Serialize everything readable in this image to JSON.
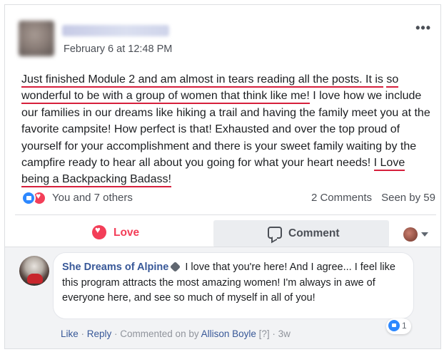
{
  "post": {
    "timestamp": "February 6 at 12:48 PM",
    "text": {
      "hl_1": "Just finished Module 2 and am almost in tears reading all the posts. It is",
      "hl_2": "so wonderful to be with a group of women that think like me!",
      "plain_1": " I love how we include our families in our dreams like hiking a trail and having the family meet you at the favorite campsite! How perfect is that! Exhausted and over the top proud of yourself for your accomplishment and there is your sweet family waiting by the campfire ready to hear all about you going for what your heart needs! ",
      "hl_3": "I Love being a Backpacking Badass!"
    },
    "highlight_color": "#d61f3c",
    "more_label": "•••"
  },
  "reactions": {
    "icons": [
      "like-icon",
      "love-icon"
    ],
    "reactors": "You and 7 others",
    "comments": "2 Comments",
    "seen_by": "Seen by 59"
  },
  "actions": {
    "love_label": "Love",
    "comment_label": "Comment"
  },
  "comment": {
    "author": "She Dreams of Alpine",
    "text": " I love that you're here! And I agree... I feel like this program attracts the most amazing women! I'm always in awe of everyone here, and see so much of myself in all of you!",
    "like_count": "1",
    "meta": {
      "like": "Like",
      "sep1": " · ",
      "reply": "Reply",
      "commented_on_by": " · Commented on by ",
      "by_author": "Allison Boyle",
      "help": " [?]",
      "time": " · 3w"
    }
  },
  "colors": {
    "link": "#385898",
    "love": "#f33e58",
    "like": "#2d88ff"
  }
}
